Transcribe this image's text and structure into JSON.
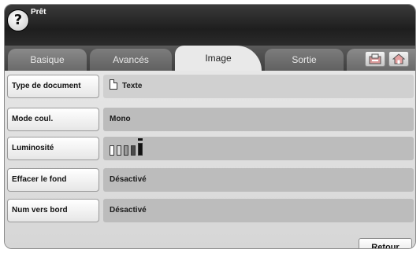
{
  "status": {
    "help_glyph": "?",
    "text": "Prêt"
  },
  "tabs": [
    {
      "label": "Basique",
      "active": false
    },
    {
      "label": "Avancés",
      "active": false
    },
    {
      "label": "Image",
      "active": true
    },
    {
      "label": "Sortie",
      "active": false
    }
  ],
  "toolbar_icons": [
    "job-status-icon",
    "home-icon"
  ],
  "settings": {
    "document_type": {
      "label": "Type de document",
      "value": "Texte",
      "icon": "document-icon"
    },
    "color_mode": {
      "label": "Mode coul.",
      "value": "Mono"
    },
    "brightness": {
      "label": "Luminosité",
      "level": 5,
      "max_level": 5,
      "icon": "brightness-scale-icon"
    },
    "erase_background": {
      "label": "Effacer le fond",
      "value": "Désactivé"
    },
    "edge_to_edge": {
      "label": "Num vers bord",
      "value": "Désactivé"
    }
  },
  "footer": {
    "back_label": "Retour"
  }
}
